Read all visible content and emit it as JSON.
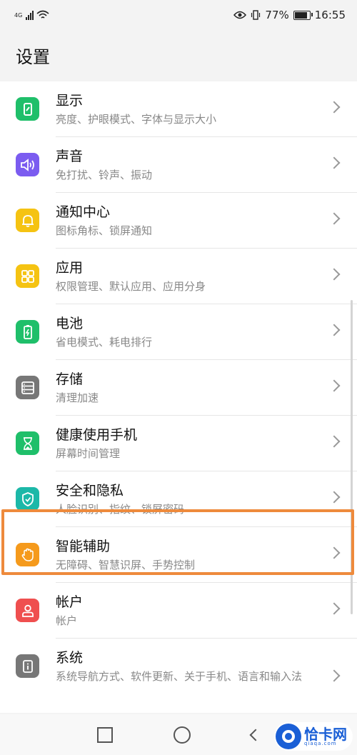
{
  "status_bar": {
    "network": "4G",
    "battery": "77%",
    "time": "16:55"
  },
  "header": {
    "title": "设置"
  },
  "settings": [
    {
      "label": "显示",
      "sub": "亮度、护眼模式、字体与显示大小",
      "icon": "display-icon",
      "color": "#1fbf6a"
    },
    {
      "label": "声音",
      "sub": "免打扰、铃声、振动",
      "icon": "speaker-icon",
      "color": "#7b5cf0"
    },
    {
      "label": "通知中心",
      "sub": "图标角标、锁屏通知",
      "icon": "bell-icon",
      "color": "#f5c312"
    },
    {
      "label": "应用",
      "sub": "权限管理、默认应用、应用分身",
      "icon": "grid-icon",
      "color": "#f5c312"
    },
    {
      "label": "电池",
      "sub": "省电模式、耗电排行",
      "icon": "battery-icon",
      "color": "#1fbf6a"
    },
    {
      "label": "存储",
      "sub": "清理加速",
      "icon": "storage-icon",
      "color": "#777777"
    },
    {
      "label": "健康使用手机",
      "sub": "屏幕时间管理",
      "icon": "hourglass-icon",
      "color": "#1fbf6a"
    },
    {
      "label": "安全和隐私",
      "sub": "人脸识别、指纹、锁屏密码",
      "icon": "shield-icon",
      "color": "#1cb8a8"
    },
    {
      "label": "智能辅助",
      "sub": "无障碍、智慧识屏、手势控制",
      "icon": "hand-icon",
      "color": "#f59a1c"
    },
    {
      "label": "帐户",
      "sub": "帐户",
      "icon": "account-icon",
      "color": "#ef4f4f"
    },
    {
      "label": "系统",
      "sub": "系统导航方式、软件更新、关于手机、语言和输入法",
      "icon": "system-info-icon",
      "color": "#777777"
    }
  ],
  "watermark": {
    "name": "恰卡网",
    "url": "qiaqa.com"
  },
  "highlight_color": "#ee8a3c"
}
